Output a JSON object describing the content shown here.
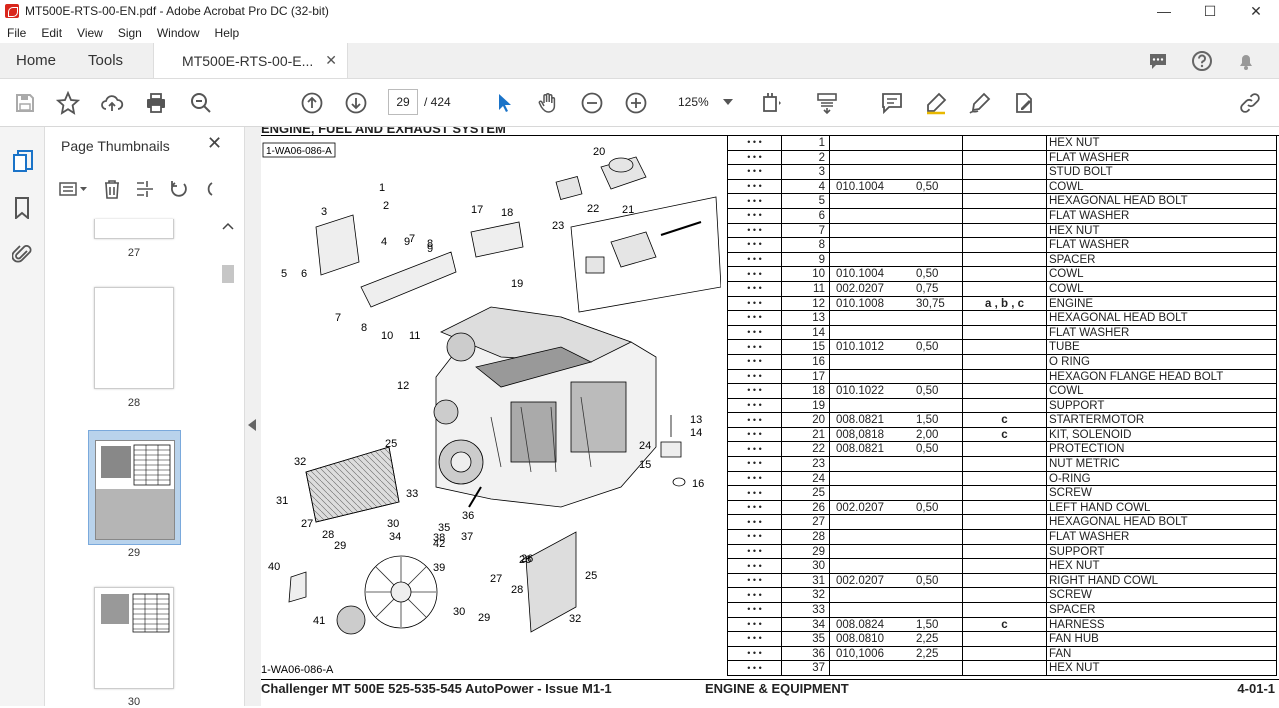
{
  "window": {
    "title": "MT500E-RTS-00-EN.pdf - Adobe Acrobat Pro DC (32-bit)"
  },
  "menu": [
    "File",
    "Edit",
    "View",
    "Sign",
    "Window",
    "Help"
  ],
  "tabs": {
    "home": "Home",
    "tools": "Tools",
    "doc": "MT500E-RTS-00-E...",
    "close": "✕"
  },
  "toolbar": {
    "page": "29",
    "total": "/ 424",
    "zoom": "125%"
  },
  "panel": {
    "title": "Page Thumbnails",
    "close": "✕",
    "thumbs": [
      "27",
      "28",
      "29",
      "30"
    ]
  },
  "page": {
    "header_cut": "ENGINE, FUEL AND EXHAUST SYSTEM",
    "ref_top": "1-WA06-086-A",
    "ref_bottom": "1-WA06-086-A",
    "footer_left": "Challenger MT 500E 525-535-545 AutoPower - Issue M1-1",
    "footer_mid": "ENGINE & EQUIPMENT",
    "footer_right": "4-01-1",
    "callouts": [
      "1",
      "2",
      "3",
      "4",
      "5",
      "6",
      "7",
      "8",
      "9",
      "10",
      "11",
      "12",
      "13",
      "14",
      "15",
      "16",
      "17",
      "18",
      "19",
      "20",
      "21",
      "22",
      "23",
      "24",
      "25",
      "26",
      "27",
      "28",
      "29",
      "30",
      "31",
      "32",
      "33",
      "34",
      "35",
      "36",
      "37",
      "38",
      "39",
      "40",
      "41",
      "42",
      "25",
      "26",
      "27",
      "28",
      "29",
      "30",
      "32",
      "7",
      "8",
      "9"
    ],
    "parts": [
      {
        "n": "1",
        "code": "",
        "qty": "",
        "note": "",
        "desc": "HEX NUT"
      },
      {
        "n": "2",
        "code": "",
        "qty": "",
        "note": "",
        "desc": "FLAT WASHER"
      },
      {
        "n": "3",
        "code": "",
        "qty": "",
        "note": "",
        "desc": "STUD BOLT"
      },
      {
        "n": "4",
        "code": "010.1004",
        "qty": "0,50",
        "note": "",
        "desc": "COWL"
      },
      {
        "n": "5",
        "code": "",
        "qty": "",
        "note": "",
        "desc": "HEXAGONAL HEAD BOLT"
      },
      {
        "n": "6",
        "code": "",
        "qty": "",
        "note": "",
        "desc": "FLAT WASHER"
      },
      {
        "n": "7",
        "code": "",
        "qty": "",
        "note": "",
        "desc": "HEX NUT"
      },
      {
        "n": "8",
        "code": "",
        "qty": "",
        "note": "",
        "desc": "FLAT WASHER"
      },
      {
        "n": "9",
        "code": "",
        "qty": "",
        "note": "",
        "desc": "SPACER"
      },
      {
        "n": "10",
        "code": "010.1004",
        "qty": "0,50",
        "note": "",
        "desc": "COWL"
      },
      {
        "n": "11",
        "code": "002.0207",
        "qty": "0,75",
        "note": "",
        "desc": "COWL"
      },
      {
        "n": "12",
        "code": "010.1008",
        "qty": "30,75",
        "note": "a , b , c",
        "desc": "ENGINE"
      },
      {
        "n": "13",
        "code": "",
        "qty": "",
        "note": "",
        "desc": "HEXAGONAL HEAD BOLT"
      },
      {
        "n": "14",
        "code": "",
        "qty": "",
        "note": "",
        "desc": "FLAT WASHER"
      },
      {
        "n": "15",
        "code": "010.1012",
        "qty": "0,50",
        "note": "",
        "desc": "TUBE"
      },
      {
        "n": "16",
        "code": "",
        "qty": "",
        "note": "",
        "desc": "O RING"
      },
      {
        "n": "17",
        "code": "",
        "qty": "",
        "note": "",
        "desc": "HEXAGON FLANGE HEAD BOLT"
      },
      {
        "n": "18",
        "code": "010.1022",
        "qty": "0,50",
        "note": "",
        "desc": "COWL"
      },
      {
        "n": "19",
        "code": "",
        "qty": "",
        "note": "",
        "desc": "SUPPORT"
      },
      {
        "n": "20",
        "code": "008.0821",
        "qty": "1,50",
        "note": "c",
        "desc": "STARTERMOTOR"
      },
      {
        "n": "21",
        "code": "008,0818",
        "qty": "2,00",
        "note": "c",
        "desc": "KIT, SOLENOID"
      },
      {
        "n": "22",
        "code": "008.0821",
        "qty": "0,50",
        "note": "",
        "desc": "PROTECTION"
      },
      {
        "n": "23",
        "code": "",
        "qty": "",
        "note": "",
        "desc": "NUT METRIC"
      },
      {
        "n": "24",
        "code": "",
        "qty": "",
        "note": "",
        "desc": "O-RING"
      },
      {
        "n": "25",
        "code": "",
        "qty": "",
        "note": "",
        "desc": "SCREW"
      },
      {
        "n": "26",
        "code": "002.0207",
        "qty": "0,50",
        "note": "",
        "desc": "LEFT HAND COWL"
      },
      {
        "n": "27",
        "code": "",
        "qty": "",
        "note": "",
        "desc": "HEXAGONAL HEAD BOLT"
      },
      {
        "n": "28",
        "code": "",
        "qty": "",
        "note": "",
        "desc": "FLAT WASHER"
      },
      {
        "n": "29",
        "code": "",
        "qty": "",
        "note": "",
        "desc": "SUPPORT"
      },
      {
        "n": "30",
        "code": "",
        "qty": "",
        "note": "",
        "desc": "HEX NUT"
      },
      {
        "n": "31",
        "code": "002.0207",
        "qty": "0,50",
        "note": "",
        "desc": "RIGHT HAND COWL"
      },
      {
        "n": "32",
        "code": "",
        "qty": "",
        "note": "",
        "desc": "SCREW"
      },
      {
        "n": "33",
        "code": "",
        "qty": "",
        "note": "",
        "desc": "SPACER"
      },
      {
        "n": "34",
        "code": "008.0824",
        "qty": "1,50",
        "note": "c",
        "desc": "HARNESS"
      },
      {
        "n": "35",
        "code": "008.0810",
        "qty": "2,25",
        "note": "",
        "desc": "FAN HUB"
      },
      {
        "n": "36",
        "code": "010,1006",
        "qty": "2,25",
        "note": "",
        "desc": "FAN"
      },
      {
        "n": "37",
        "code": "",
        "qty": "",
        "note": "",
        "desc": "HEX NUT"
      }
    ]
  }
}
